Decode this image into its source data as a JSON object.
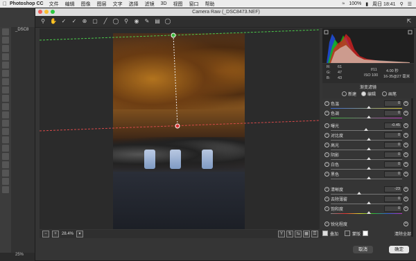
{
  "menubar": {
    "app": "Photoshop CC",
    "items": [
      "文件",
      "编辑",
      "图像",
      "图层",
      "文字",
      "选择",
      "滤镜",
      "3D",
      "视图",
      "窗口",
      "帮助"
    ],
    "battery": "100%",
    "clock": "周日 18:41"
  },
  "doc_tab": "_DSC8",
  "ps_zoom": "25%",
  "cameraraw": {
    "title": "Camera Raw (_DSC8473.NEF)",
    "zoom": "28.4%",
    "info": {
      "r": "61",
      "g": "47",
      "b": "43",
      "r_lbl": "R:",
      "g_lbl": "G:",
      "b_lbl": "B:",
      "aperture": "f/11",
      "shutter": "4.00 秒",
      "iso": "ISO 100",
      "lens": "16-35@27 毫米"
    },
    "panel_title": "渐变滤镜",
    "modes": [
      "新建",
      "编辑",
      "画笔"
    ],
    "sliders": [
      {
        "label": "色温",
        "value": "0"
      },
      {
        "label": "色调",
        "value": "0"
      },
      {
        "label": "曝光",
        "value": "-0.45"
      },
      {
        "label": "对比度",
        "value": "0"
      },
      {
        "label": "高光",
        "value": "0"
      },
      {
        "label": "阴影",
        "value": "0"
      },
      {
        "label": "白色",
        "value": "0"
      },
      {
        "label": "黑色",
        "value": "0"
      },
      {
        "label": "清晰度",
        "value": "-23"
      },
      {
        "label": "去除薄雾",
        "value": "0"
      },
      {
        "label": "饱和度",
        "value": "0"
      },
      {
        "label": "锐化程度",
        "value": ""
      }
    ],
    "footer": {
      "overlay": "叠加",
      "mask": "蒙版",
      "clear": "清除全部"
    },
    "buttons": {
      "cancel": "取消",
      "ok": "确定"
    }
  }
}
